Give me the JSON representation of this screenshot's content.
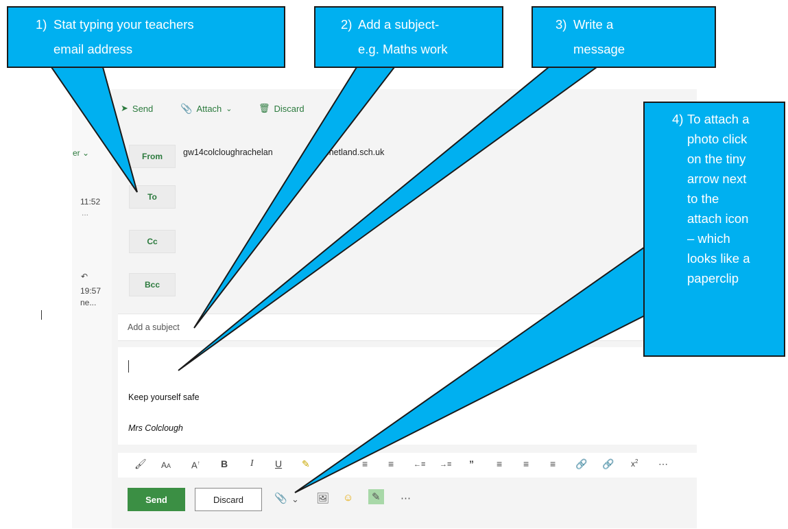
{
  "mail": {
    "toolbar": {
      "send": "Send",
      "attach": "Attach",
      "discard": "Discard"
    },
    "left_pane": {
      "folder_fragment": "er",
      "item1_time": "11:52",
      "item1_snippet": "...",
      "item2_time": "19:57",
      "item2_snippet": "ne..."
    },
    "fields": {
      "from_label": "From",
      "from_value": "gw14colcloughrachelan",
      "from_value_end": "w.shetland.sch.uk",
      "to_label": "To",
      "cc_label": "Cc",
      "bcc_label": "Bcc"
    },
    "subject_placeholder": "Add a subject",
    "body_lines": [
      "Keep yourself safe",
      "Mrs Colclough"
    ],
    "buttons": {
      "send": "Send",
      "discard": "Discard"
    }
  },
  "callouts": {
    "c1": {
      "num": "1)",
      "line1": "Stat typing your teachers",
      "line2": "email address"
    },
    "c2": {
      "num": "2)",
      "line1": "Add a subject-",
      "line2": "e.g. Maths work"
    },
    "c3": {
      "num": "3)",
      "line1": "Write a",
      "line2": "message"
    },
    "c4": {
      "num": "4)",
      "lines": [
        "To attach a",
        "photo click",
        "on the tiny",
        "arrow next",
        "to the",
        "attach icon",
        "– which",
        "looks like a",
        "paperclip"
      ]
    }
  },
  "colors": {
    "callout": "#00b0f0",
    "accent_green": "#3b8f44"
  }
}
